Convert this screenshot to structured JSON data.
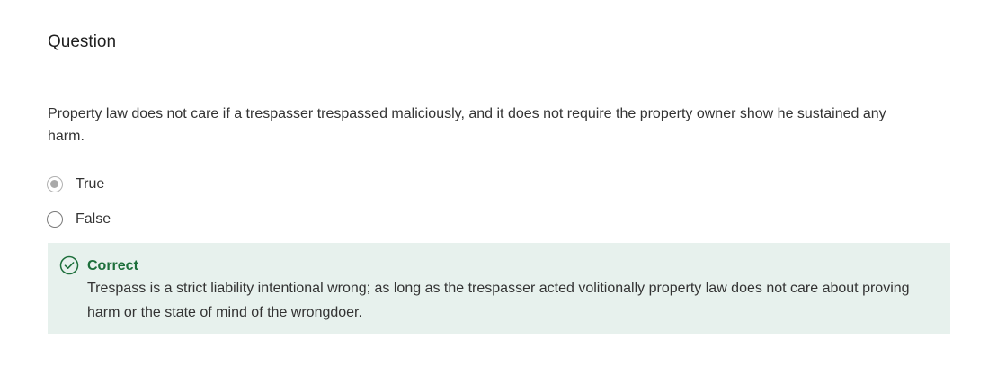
{
  "header": {
    "title": "Question"
  },
  "question": {
    "text": "Property law does not care if a trespasser trespassed maliciously, and it does not require the property owner show he sustained any harm."
  },
  "options": [
    {
      "label": "True",
      "selected": true
    },
    {
      "label": "False",
      "selected": false
    }
  ],
  "feedback": {
    "status": "Correct",
    "icon": "check-circle-icon",
    "color": "#1d6f3b",
    "background": "#e7f1ed",
    "text": "Trespass is a strict liability intentional wrong; as long as the trespasser acted volitionally property law does not care about proving harm or the state of mind of the wrongdoer."
  }
}
